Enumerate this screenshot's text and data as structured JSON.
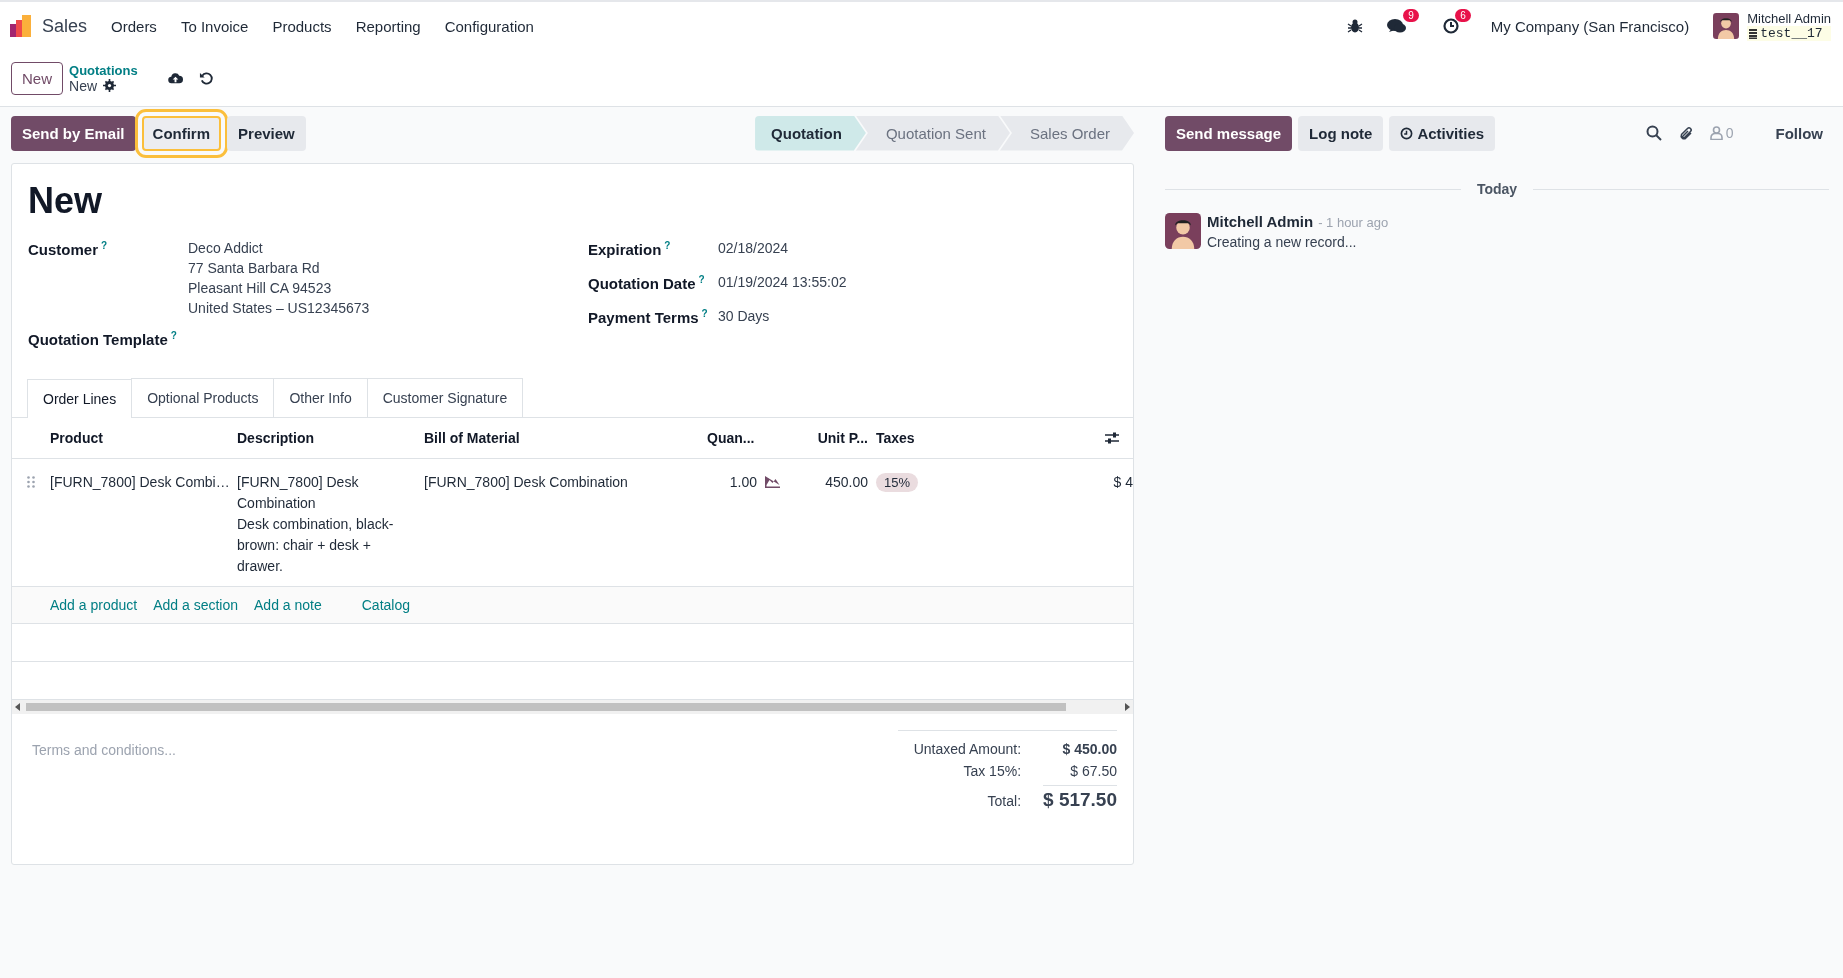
{
  "navbar": {
    "app": "Sales",
    "menu": [
      "Orders",
      "To Invoice",
      "Products",
      "Reporting",
      "Configuration"
    ],
    "messages_badge": "9",
    "activities_badge": "6",
    "company": "My Company (San Francisco)",
    "user": "Mitchell Admin",
    "database": "test__17"
  },
  "breadcrumb": {
    "new_button": "New",
    "parent": "Quotations",
    "current": "New"
  },
  "actions": [
    {
      "label": "Send by Email",
      "kind": "primary",
      "highlighted": false
    },
    {
      "label": "Confirm",
      "kind": "secondary",
      "highlighted": true
    },
    {
      "label": "Preview",
      "kind": "secondary",
      "highlighted": false
    }
  ],
  "status_bar": [
    {
      "label": "Quotation",
      "selected": true
    },
    {
      "label": "Quotation Sent",
      "selected": false
    },
    {
      "label": "Sales Order",
      "selected": false
    }
  ],
  "form": {
    "title": "New",
    "left_fields": [
      {
        "label": "Customer",
        "help": "?",
        "value_lines": [
          "Deco Addict",
          "77 Santa Barbara Rd",
          "Pleasant Hill CA 94523",
          "United States – US12345673"
        ]
      },
      {
        "label": "Quotation Template",
        "help": "?"
      }
    ],
    "right_fields": [
      {
        "label": "Expiration",
        "help": "?",
        "value_lines": [
          "02/18/2024"
        ]
      },
      {
        "label": "Quotation Date",
        "help": "?",
        "value_lines": [
          "01/19/2024 13:55:02"
        ]
      },
      {
        "label": "Payment Terms",
        "help": "?",
        "value_lines": [
          "30 Days"
        ]
      }
    ]
  },
  "tabs": [
    {
      "label": "Order Lines",
      "selected": true
    },
    {
      "label": "Optional Products",
      "selected": false
    },
    {
      "label": "Other Info",
      "selected": false
    },
    {
      "label": "Customer Signature",
      "selected": false
    }
  ],
  "table": {
    "columns": [
      "Product",
      "Description",
      "Bill of Material",
      "Quan...",
      "Unit P...",
      "Taxes"
    ],
    "rows": [
      {
        "product": "[FURN_7800] Desk Combi…",
        "description_lines": [
          "[FURN_7800] Desk Combination",
          "Desk combination, black-brown: chair + desk + drawer."
        ],
        "bill_of_material": "[FURN_7800] Desk Combination",
        "quantity": "1.00",
        "unit_price": "450.00",
        "taxes": [
          "15%"
        ],
        "column_9": "$ 4"
      }
    ],
    "add_links": [
      "Add a product",
      "Add a section",
      "Add a note",
      "Catalog"
    ]
  },
  "terms_placeholder": "Terms and conditions...",
  "totals": [
    {
      "label": "Untaxed Amount:",
      "value": "$ 450.00",
      "kind": "subtotal"
    },
    {
      "label": "Tax 15%:",
      "value": "$ 67.50",
      "kind": "tax"
    },
    {
      "label": "Total:",
      "value": "$ 517.50",
      "kind": "total"
    }
  ],
  "chatter": {
    "buttons": [
      {
        "label": "Send message",
        "kind": "primary"
      },
      {
        "label": "Log note",
        "kind": "secondary"
      },
      {
        "label": "Activities",
        "kind": "activities"
      }
    ],
    "followers_count": "0",
    "follow": "Follow",
    "date_separator": "Today",
    "messages": [
      {
        "author": "Mitchell Admin",
        "time": "- 1 hour ago",
        "body": "Creating a new record..."
      }
    ]
  }
}
